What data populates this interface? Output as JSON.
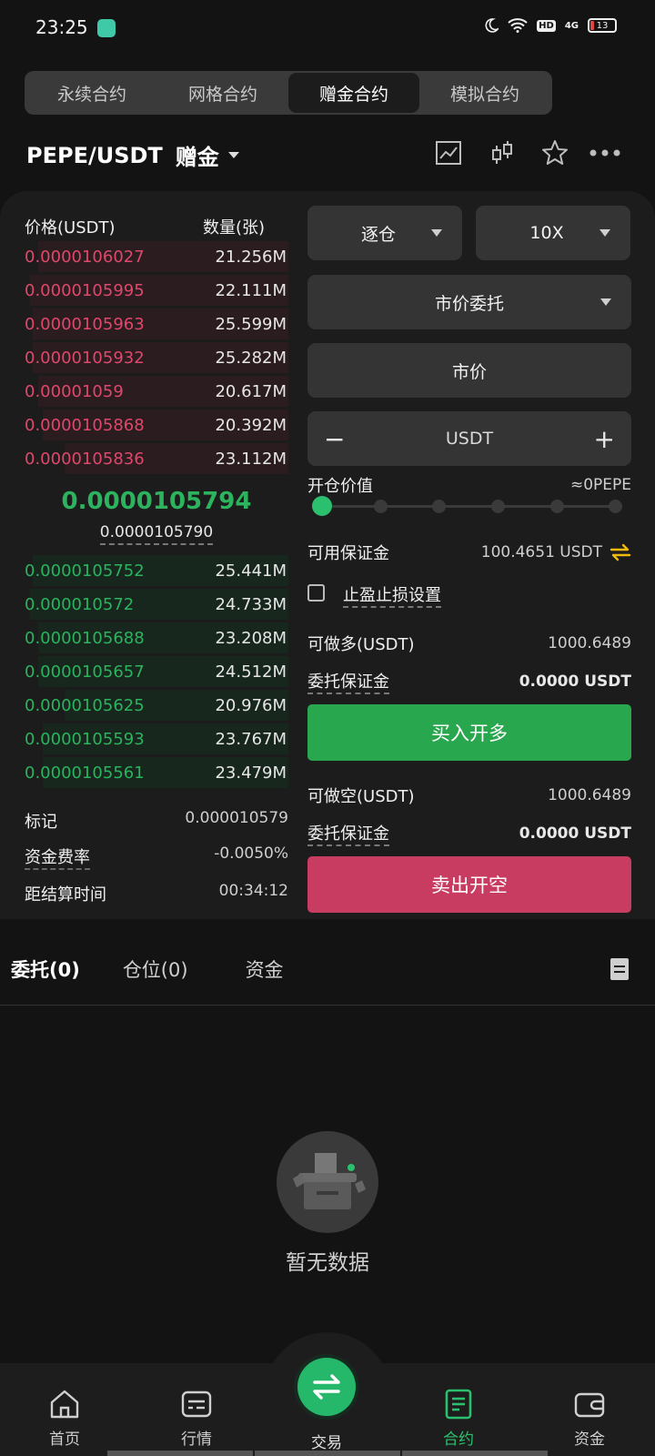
{
  "status": {
    "time": "23:25",
    "battery": "13",
    "network": "4G"
  },
  "tabs": [
    {
      "label": "永续合约"
    },
    {
      "label": "网格合约"
    },
    {
      "label": "赠金合约"
    },
    {
      "label": "模拟合约"
    }
  ],
  "pair": {
    "name": "PEPE/USDT",
    "tag": "赠金"
  },
  "orderbook": {
    "price_header": "价格(USDT)",
    "qty_header": "数量(张)",
    "asks": [
      {
        "price": "0.0000106027",
        "qty": "21.256M",
        "depth": 0.95
      },
      {
        "price": "0.0000105995",
        "qty": "22.111M",
        "depth": 0.98
      },
      {
        "price": "0.0000105963",
        "qty": "25.599M",
        "depth": 0.97
      },
      {
        "price": "0.0000105932",
        "qty": "25.282M",
        "depth": 0.97
      },
      {
        "price": "0.00001059",
        "qty": "20.617M",
        "depth": 0.95
      },
      {
        "price": "0.0000105868",
        "qty": "20.392M",
        "depth": 0.93
      },
      {
        "price": "0.0000105836",
        "qty": "23.112M",
        "depth": 0.85
      }
    ],
    "last_price": "0.0000105794",
    "mark_price": "0.0000105790",
    "bids": [
      {
        "price": "0.0000105752",
        "qty": "25.441M",
        "depth": 0.97
      },
      {
        "price": "0.000010572",
        "qty": "24.733M",
        "depth": 0.98
      },
      {
        "price": "0.0000105688",
        "qty": "23.208M",
        "depth": 0.95
      },
      {
        "price": "0.0000105657",
        "qty": "24.512M",
        "depth": 0.95
      },
      {
        "price": "0.0000105625",
        "qty": "20.976M",
        "depth": 0.85
      },
      {
        "price": "0.0000105593",
        "qty": "23.767M",
        "depth": 0.93
      },
      {
        "price": "0.0000105561",
        "qty": "23.479M",
        "depth": 0.93
      }
    ]
  },
  "stats": [
    {
      "label": "标记",
      "value": "0.000010579"
    },
    {
      "label": "资金费率",
      "value": "-0.0050%"
    },
    {
      "label": "距结算时间",
      "value": "00:34:12"
    }
  ],
  "order": {
    "margin_mode": "逐仓",
    "leverage": "10X",
    "order_type": "市价委托",
    "price": "市价",
    "amount_placeholder": "USDT",
    "open_value_label": "开仓价值",
    "open_value": "≈0PEPE",
    "slider_percent": 0,
    "available_label": "可用保证金",
    "available_value": "100.4651 USDT",
    "tpsl_label": "止盈止损设置",
    "long_label": "可做多(USDT)",
    "long_value": "1000.6489",
    "long_margin_label": "委托保证金",
    "long_margin_value": "0.0000 USDT",
    "buy_label": "买入开多",
    "short_label": "可做空(USDT)",
    "short_value": "1000.6489",
    "short_margin_label": "委托保证金",
    "short_margin_value": "0.0000 USDT",
    "sell_label": "卖出开空"
  },
  "bottom_tabs": [
    {
      "label": "委托(0)"
    },
    {
      "label": "仓位(0)"
    },
    {
      "label": "资金"
    }
  ],
  "empty": {
    "text": "暂无数据"
  },
  "nav": [
    {
      "label": "首页"
    },
    {
      "label": "行情"
    },
    {
      "label": "交易"
    },
    {
      "label": "合约"
    },
    {
      "label": "资金"
    }
  ],
  "colors": {
    "up": "#2bb35e",
    "down": "#e0486b",
    "buy": "#29a74f",
    "sell": "#c83c61"
  }
}
